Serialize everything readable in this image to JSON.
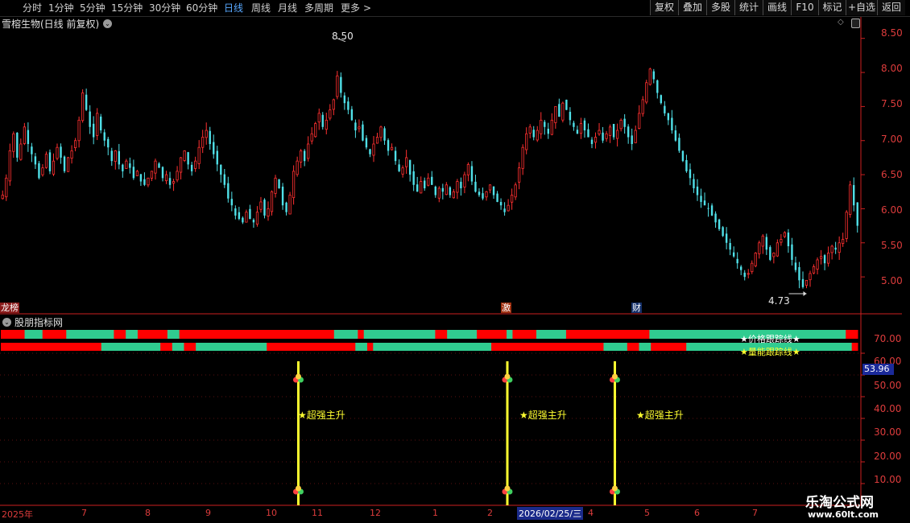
{
  "toolbar": {
    "periods": [
      "分时",
      "1分钟",
      "5分钟",
      "15分钟",
      "30分钟",
      "60分钟",
      "日线",
      "周线",
      "月线",
      "多周期",
      "更多"
    ],
    "active_period": "日线",
    "more_arrow": ">",
    "buttons": [
      "复权",
      "叠加",
      "多股",
      "统计",
      "画线",
      "F10",
      "标记",
      "+自选",
      "返回"
    ]
  },
  "main_chart": {
    "title": "雪榕生物(日线 前复权)",
    "high_label": "8.50",
    "low_label": "4.73",
    "y_ticks": [
      "8.50",
      "8.00",
      "7.50",
      "7.00",
      "6.50",
      "6.00",
      "5.50",
      "5.00"
    ],
    "event_tags": [
      "龙榜",
      "激",
      "财"
    ],
    "colors": {
      "up": "#ff3030",
      "down": "#50e0e8",
      "axis": "#cc2020"
    }
  },
  "indicator": {
    "title": "股朋指标网",
    "legend_price": "★价格跟踪线★",
    "legend_volume": "★量能跟踪线★",
    "signal_label": "★超强主升",
    "current_value": "53.96",
    "y_ticks": [
      "70.00",
      "60.00",
      "50.00",
      "40.00",
      "30.00",
      "20.00",
      "10.00"
    ],
    "colors": {
      "red": "#ff0000",
      "green": "#30cc90",
      "signal": "#ffff30"
    }
  },
  "x_axis": {
    "labels": [
      "2025年",
      "7",
      "8",
      "9",
      "10",
      "11",
      "12",
      "1",
      "2",
      "2026/02/25/三",
      "4",
      "5",
      "6",
      "7"
    ]
  },
  "watermark": {
    "name": "乐淘公式网",
    "url": "www.60lt.com"
  },
  "chart_data": {
    "type": "candlestick",
    "title": "雪榕生物(日线 前复权)",
    "ylim": [
      4.6,
      8.65
    ],
    "high": 8.5,
    "low": 4.73,
    "closes": [
      6.2,
      6.45,
      6.85,
      7.1,
      6.75,
      6.95,
      7.2,
      6.95,
      6.8,
      6.65,
      6.45,
      6.6,
      6.8,
      6.55,
      6.7,
      6.9,
      6.75,
      6.55,
      6.75,
      6.85,
      7.0,
      7.3,
      7.7,
      7.45,
      7.2,
      7.05,
      7.4,
      7.15,
      7.0,
      6.9,
      6.7,
      6.85,
      6.65,
      6.55,
      6.7,
      6.6,
      6.45,
      6.55,
      6.4,
      6.35,
      6.45,
      6.55,
      6.7,
      6.6,
      6.45,
      6.5,
      6.35,
      6.4,
      6.55,
      6.75,
      6.85,
      6.65,
      6.55,
      6.7,
      6.9,
      7.05,
      7.15,
      6.95,
      6.8,
      6.65,
      6.5,
      6.35,
      6.15,
      6.05,
      5.9,
      5.85,
      5.8,
      5.95,
      5.85,
      5.8,
      5.95,
      6.1,
      5.9,
      6.0,
      6.25,
      6.45,
      6.3,
      6.05,
      5.95,
      6.2,
      6.55,
      6.7,
      6.85,
      6.7,
      6.95,
      7.1,
      7.25,
      7.4,
      7.2,
      7.3,
      7.45,
      7.6,
      7.95,
      7.7,
      7.55,
      7.45,
      7.3,
      7.15,
      7.2,
      7.0,
      6.9,
      6.8,
      6.95,
      7.05,
      7.2,
      7.0,
      6.85,
      6.9,
      6.7,
      6.55,
      6.6,
      6.75,
      6.5,
      6.35,
      6.25,
      6.4,
      6.3,
      6.45,
      6.35,
      6.2,
      6.3,
      6.25,
      6.35,
      6.2,
      6.25,
      6.4,
      6.3,
      6.5,
      6.65,
      6.4,
      6.25,
      6.2,
      6.15,
      6.25,
      6.35,
      6.2,
      6.1,
      6.05,
      5.95,
      6.05,
      6.2,
      6.35,
      6.6,
      6.9,
      7.1,
      7.2,
      7.05,
      7.15,
      7.3,
      7.2,
      7.1,
      7.3,
      7.5,
      7.35,
      7.55,
      7.45,
      7.3,
      7.2,
      7.1,
      7.25,
      7.15,
      7.05,
      6.95,
      7.05,
      7.15,
      7.0,
      7.1,
      7.2,
      7.05,
      7.15,
      7.3,
      7.2,
      7.05,
      6.95,
      7.15,
      7.4,
      7.6,
      7.85,
      8.05,
      7.9,
      7.7,
      7.55,
      7.4,
      7.3,
      7.15,
      7.0,
      6.85,
      6.7,
      6.55,
      6.45,
      6.3,
      6.2,
      6.1,
      6.05,
      6.0,
      5.9,
      5.8,
      5.7,
      5.6,
      5.5,
      5.4,
      5.3,
      5.2,
      5.1,
      5.0,
      5.05,
      5.2,
      5.35,
      5.5,
      5.6,
      5.4,
      5.25,
      5.35,
      5.5,
      5.55,
      5.65,
      5.45,
      5.25,
      5.1,
      4.95,
      4.85,
      4.95,
      5.05,
      5.15,
      5.25,
      5.3,
      5.2,
      5.35,
      5.45,
      5.4,
      5.5,
      5.55,
      5.95,
      6.35,
      6.05,
      5.75
    ],
    "band_price": [
      "r",
      "r",
      "r",
      "r",
      "g",
      "g",
      "g",
      "r",
      "r",
      "r",
      "r",
      "g",
      "g",
      "g",
      "g",
      "g",
      "g",
      "g",
      "g",
      "r",
      "r",
      "g",
      "g",
      "r",
      "r",
      "r",
      "r",
      "r",
      "g",
      "g",
      "r",
      "r",
      "r",
      "r",
      "r",
      "r",
      "r",
      "r",
      "r",
      "r",
      "r",
      "r",
      "r",
      "r",
      "r",
      "r",
      "r",
      "r",
      "r",
      "r",
      "r",
      "r",
      "r",
      "r",
      "r",
      "r",
      "g",
      "g",
      "g",
      "g",
      "r",
      "g",
      "g",
      "g",
      "g",
      "g",
      "g",
      "g",
      "g",
      "g",
      "g",
      "g",
      "g",
      "r",
      "r",
      "g",
      "g",
      "g",
      "g",
      "g",
      "r",
      "r",
      "r",
      "r",
      "r",
      "g",
      "r",
      "r",
      "r",
      "r",
      "g",
      "g",
      "g",
      "g",
      "g",
      "r",
      "r",
      "r",
      "r",
      "r",
      "r",
      "r",
      "r",
      "r",
      "r",
      "r",
      "r",
      "r",
      "r",
      "g",
      "g",
      "g",
      "g",
      "g",
      "g",
      "g",
      "g",
      "g",
      "g",
      "g",
      "g",
      "g",
      "g",
      "g",
      "g",
      "g",
      "g",
      "g",
      "g",
      "g",
      "g",
      "g",
      "g",
      "g",
      "g",
      "g",
      "g",
      "g",
      "g",
      "g",
      "g",
      "g",
      "r",
      "r"
    ],
    "band_volume": [
      "r",
      "r",
      "r",
      "r",
      "r",
      "r",
      "r",
      "r",
      "r",
      "r",
      "r",
      "r",
      "r",
      "r",
      "r",
      "r",
      "r",
      "g",
      "g",
      "g",
      "g",
      "g",
      "g",
      "g",
      "g",
      "g",
      "g",
      "r",
      "r",
      "g",
      "g",
      "r",
      "r",
      "g",
      "g",
      "g",
      "g",
      "g",
      "g",
      "g",
      "g",
      "g",
      "g",
      "g",
      "g",
      "r",
      "r",
      "r",
      "r",
      "r",
      "r",
      "r",
      "r",
      "r",
      "r",
      "r",
      "r",
      "r",
      "r",
      "r",
      "g",
      "g",
      "r",
      "g",
      "g",
      "g",
      "g",
      "g",
      "g",
      "g",
      "g",
      "g",
      "g",
      "g",
      "g",
      "g",
      "g",
      "g",
      "g",
      "g",
      "g",
      "g",
      "g",
      "r",
      "r",
      "r",
      "r",
      "r",
      "r",
      "r",
      "r",
      "r",
      "r",
      "r",
      "r",
      "r",
      "r",
      "r",
      "r",
      "r",
      "r",
      "r",
      "g",
      "g",
      "g",
      "g",
      "r",
      "r",
      "g",
      "g",
      "r",
      "r",
      "r",
      "r",
      "r",
      "r",
      "g",
      "g",
      "g",
      "g",
      "g",
      "g",
      "g",
      "g",
      "g",
      "g",
      "g",
      "g",
      "g",
      "g",
      "g",
      "g",
      "g",
      "g",
      "g",
      "g",
      "g",
      "g",
      "g",
      "g",
      "g",
      "g",
      "g",
      "g",
      "r"
    ],
    "signals_at_fraction": [
      0.345,
      0.588,
      0.713
    ],
    "indicator_ylim": [
      0,
      80
    ]
  }
}
